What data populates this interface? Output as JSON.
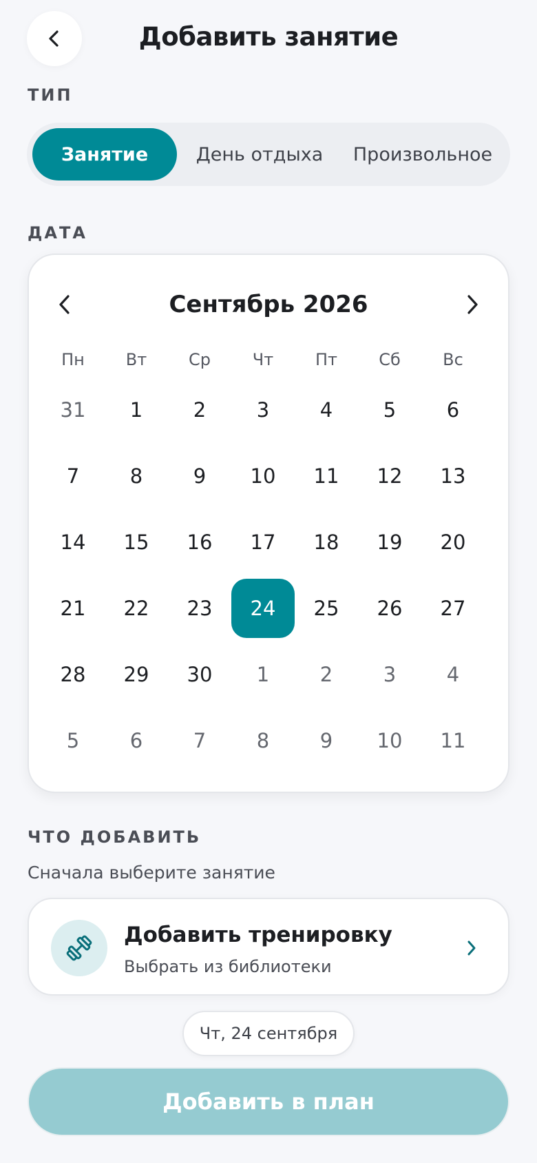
{
  "header": {
    "title": "Добавить занятие",
    "back_icon": "chevron-left-icon"
  },
  "type_section": {
    "label": "ТИП",
    "options": [
      "Занятие",
      "День отдыха",
      "Произвольное"
    ],
    "selected": "Занятие"
  },
  "date_section": {
    "label": "ДАТА",
    "month_title": "Сентябрь 2026",
    "weekdays": [
      "Пн",
      "Вт",
      "Ср",
      "Чт",
      "Пт",
      "Сб",
      "Вс"
    ],
    "weeks": [
      [
        "31",
        "1",
        "2",
        "3",
        "4",
        "5",
        "6"
      ],
      [
        "7",
        "8",
        "9",
        "10",
        "11",
        "12",
        "13"
      ],
      [
        "14",
        "15",
        "16",
        "17",
        "18",
        "19",
        "20"
      ],
      [
        "21",
        "22",
        "23",
        "24",
        "25",
        "26",
        "27"
      ],
      [
        "28",
        "29",
        "30",
        "1",
        "2",
        "3",
        "4"
      ],
      [
        "5",
        "6",
        "7",
        "8",
        "9",
        "10",
        "11"
      ]
    ],
    "selected_day": "24"
  },
  "add_section": {
    "label": "ЧТО ДОБАВИТЬ",
    "hint": "Сначала выберите занятие",
    "workout_title": "Добавить тренировку",
    "workout_subtitle": "Выбрать из библиотеки",
    "workout_icon": "dumbbell-icon"
  },
  "date_chip": "Чт, 24 сентября",
  "primary_button": "Добавить в план",
  "colors": {
    "accent": "#008a96",
    "accent_disabled": "#95cbd1",
    "background": "#f6f7fa"
  }
}
